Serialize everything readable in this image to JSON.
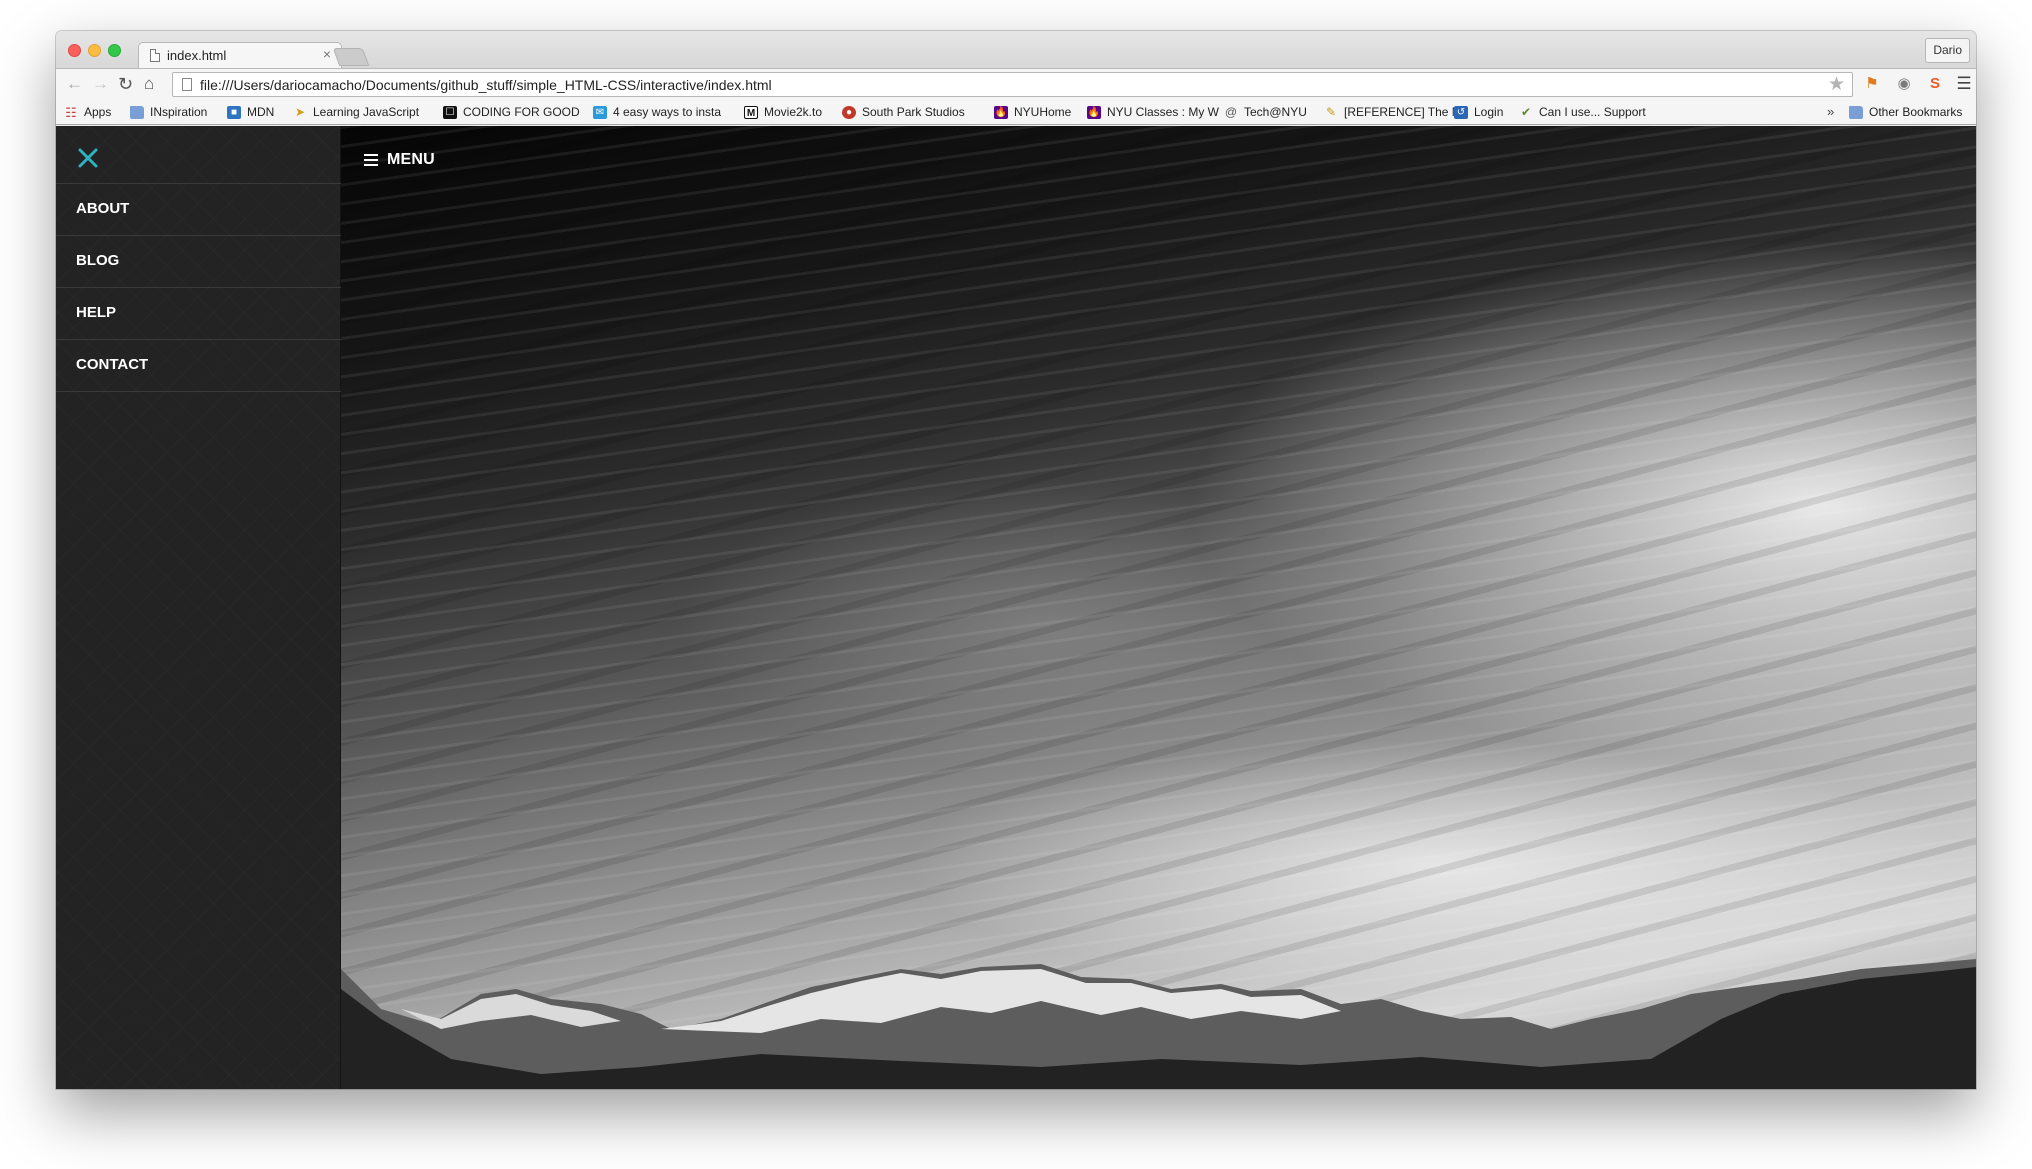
{
  "browser": {
    "tab_title": "index.html",
    "tab_close": "×",
    "profile_name": "Dario",
    "url": "file:///Users/dariocamacho/Documents/github_stuff/simple_HTML-CSS/interactive/index.html",
    "bookmarks": [
      {
        "label": "Apps",
        "icon": "apps-grid-icon"
      },
      {
        "label": "INspiration",
        "icon": "folder-icon"
      },
      {
        "label": "MDN",
        "icon": "mdn-icon"
      },
      {
        "label": "Learning JavaScript",
        "icon": "js-icon"
      },
      {
        "label": "CODING FOR GOOD",
        "icon": "cfg-icon"
      },
      {
        "label": "4 easy ways to insta",
        "icon": "mail-icon"
      },
      {
        "label": "Movie2k.to",
        "icon": "movie-icon"
      },
      {
        "label": "South Park Studios",
        "icon": "southpark-icon"
      },
      {
        "label": "NYUHome",
        "icon": "nyu-icon"
      },
      {
        "label": "NYU Classes : My W",
        "icon": "nyu-icon"
      },
      {
        "label": "Tech@NYU",
        "icon": "at-icon"
      },
      {
        "label": "[REFERENCE] The N",
        "icon": "pen-icon"
      },
      {
        "label": "Login",
        "icon": "login-icon"
      },
      {
        "label": "Can I use... Support",
        "icon": "caniuse-icon"
      }
    ],
    "bookmarks_overflow": "»",
    "other_bookmarks": "Other Bookmarks"
  },
  "page": {
    "menu_label": "MENU",
    "nav_items": [
      "ABOUT",
      "BLOG",
      "HELP",
      "CONTACT"
    ]
  },
  "colors": {
    "accent": "#2bb3c0",
    "sidebar_bg": "#232323"
  }
}
